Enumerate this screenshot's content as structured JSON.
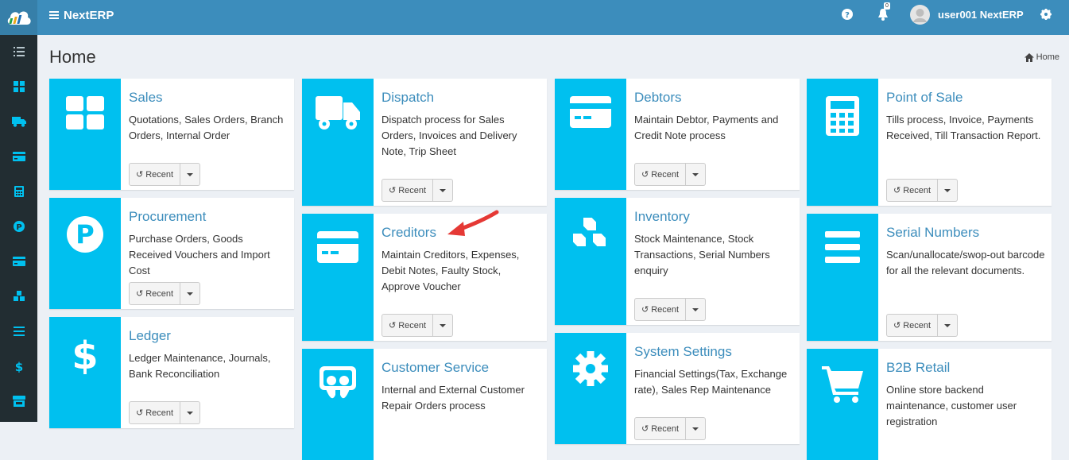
{
  "header": {
    "app_name": "NextERP",
    "notification_count": "0",
    "user_name": "user001 NextERP"
  },
  "page": {
    "title": "Home",
    "breadcrumb": "Home"
  },
  "tiles": [
    {
      "title": "Sales",
      "desc": "Quotations, Sales Orders, Branch Orders, Internal Order",
      "recent": "Recent",
      "icon": "grid-icon"
    },
    {
      "title": "Procurement",
      "desc": "Purchase Orders, Goods Received Vouchers and Import Cost",
      "recent": "Recent",
      "icon": "parking-circle-icon"
    },
    {
      "title": "Ledger",
      "desc": "Ledger Maintenance, Journals, Bank Reconciliation",
      "recent": "Recent",
      "icon": "dollar-icon"
    },
    {
      "title": "Dispatch",
      "desc": "Dispatch process for Sales Orders, Invoices and Delivery Note, Trip Sheet",
      "recent": "Recent",
      "icon": "truck-icon"
    },
    {
      "title": "Creditors",
      "desc": "Maintain Creditors, Expenses, Debit Notes, Faulty Stock, Approve Voucher",
      "recent": "Recent",
      "icon": "credit-card-icon"
    },
    {
      "title": "Customer Service",
      "desc": "Internal and External Customer Repair Orders process",
      "recent": "Recent",
      "icon": "slideshare-icon"
    },
    {
      "title": "Debtors",
      "desc": "Maintain Debtor, Payments and Credit Note process",
      "recent": "Recent",
      "icon": "credit-card-icon"
    },
    {
      "title": "Inventory",
      "desc": "Stock Maintenance, Stock Transactions, Serial Numbers enquiry",
      "recent": "Recent",
      "icon": "cubes-icon"
    },
    {
      "title": "System Settings",
      "desc": "Financial Settings(Tax, Exchange rate), Sales Rep Maintenance",
      "recent": "Recent",
      "icon": "gear-icon"
    },
    {
      "title": "Point of Sale",
      "desc": "Tills process, Invoice, Payments Received, Till Transaction Report.",
      "recent": "Recent",
      "icon": "calculator-icon"
    },
    {
      "title": "Serial Numbers",
      "desc": "Scan/unallocate/swop-out barcode for all the relevant documents.",
      "recent": "Recent",
      "icon": "list-icon"
    },
    {
      "title": "B2B Retail",
      "desc": "Online store backend maintenance, customer user registration",
      "recent": "Recent",
      "icon": "cart-icon"
    }
  ],
  "sidebar_icons": [
    "list-icon",
    "dashboard-icon",
    "truck-icon",
    "credit-card-icon",
    "calculator-icon",
    "parking-circle-icon",
    "credit-card-icon",
    "cubes-icon",
    "bars-icon",
    "dollar-icon",
    "shop-icon"
  ]
}
